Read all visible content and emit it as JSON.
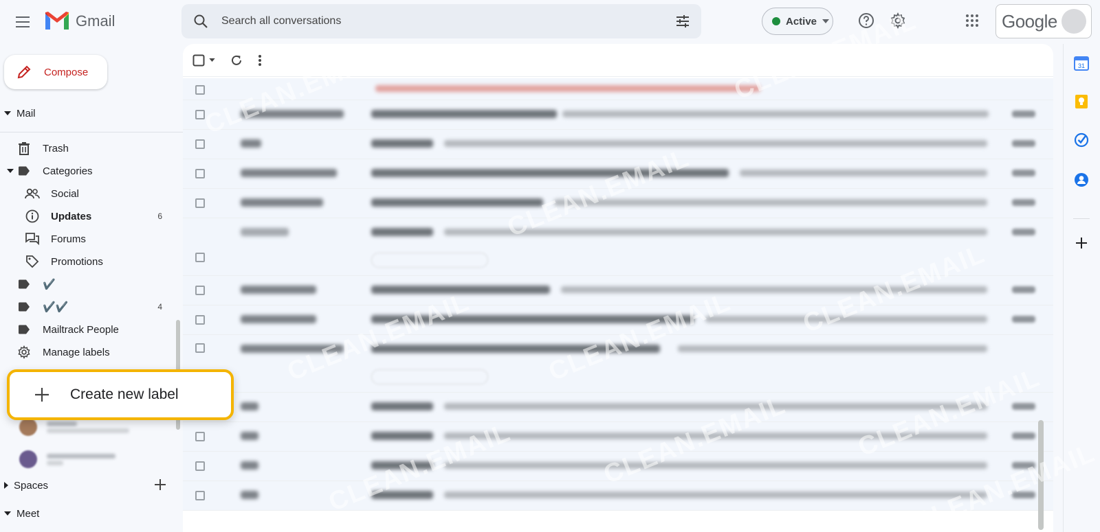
{
  "app": {
    "name": "Gmail"
  },
  "search": {
    "placeholder": "Search all conversations"
  },
  "header": {
    "status_label": "Active",
    "account_word": "Google"
  },
  "compose": {
    "label": "Compose"
  },
  "sidebar": {
    "mail_section": "Mail",
    "items": [
      {
        "label": "Trash",
        "icon": "trash-icon",
        "count": ""
      },
      {
        "label": "Categories",
        "icon": "label-icon",
        "count": ""
      },
      {
        "label": "Social",
        "icon": "people-icon",
        "count": ""
      },
      {
        "label": "Updates",
        "icon": "info-icon",
        "count": "6"
      },
      {
        "label": "Forums",
        "icon": "forum-icon",
        "count": ""
      },
      {
        "label": "Promotions",
        "icon": "tag-icon",
        "count": ""
      },
      {
        "label": "✔️",
        "icon": "label-icon",
        "count": ""
      },
      {
        "label": "✔️✔️",
        "icon": "label-icon",
        "count": "4"
      },
      {
        "label": "Mailtrack People",
        "icon": "label-icon",
        "count": ""
      },
      {
        "label": "Manage labels",
        "icon": "gear-icon",
        "count": ""
      }
    ],
    "create_label": "Create new label",
    "spaces_section": "Spaces",
    "meet_section": "Meet"
  },
  "watermark": {
    "text": "CLEAN.EMAIL"
  },
  "colors": {
    "accent_red": "#c5221f",
    "status_green": "#1e8e3e",
    "highlight": "#f4b400"
  }
}
